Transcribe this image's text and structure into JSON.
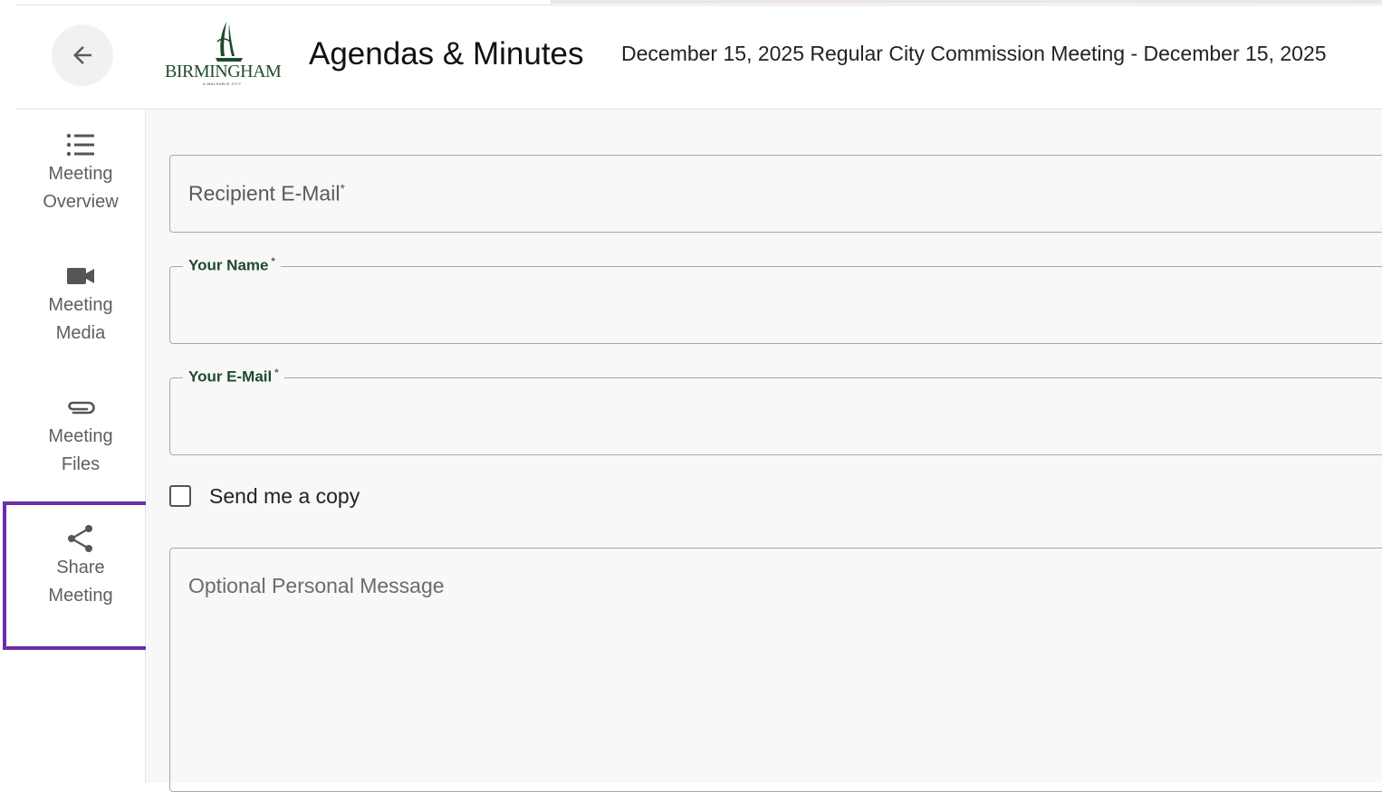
{
  "header": {
    "back_label": "Back",
    "logo_text": "BIRMINGHAM",
    "logo_tagline": "A WALKABLE CITY",
    "app_title": "Agendas & Minutes",
    "meeting_title": "December 15, 2025 Regular City Commission Meeting - December 15, 2025"
  },
  "sidebar": {
    "items": [
      {
        "line1": "Meeting",
        "line2": "Overview",
        "icon": "list-icon"
      },
      {
        "line1": "Meeting",
        "line2": "Media",
        "icon": "video-camera-icon"
      },
      {
        "line1": "Meeting",
        "line2": "Files",
        "icon": "paperclip-icon"
      },
      {
        "line1": "Share",
        "line2": "Meeting",
        "icon": "share-icon",
        "selected": true
      }
    ],
    "highlight_color": "#6f2da8"
  },
  "form": {
    "recipient_email_label": "Recipient E-Mail",
    "your_name_label": "Your Name",
    "your_email_label": "Your E-Mail",
    "required_mark": "*",
    "send_copy_label": "Send me a copy",
    "send_copy_checked": false,
    "message_placeholder": "Optional Personal Message",
    "recipient_email_value": "",
    "your_name_value": "",
    "your_email_value": ""
  },
  "colors": {
    "brand_green": "#1f4a2c",
    "accent_purple": "#6f2da8"
  }
}
